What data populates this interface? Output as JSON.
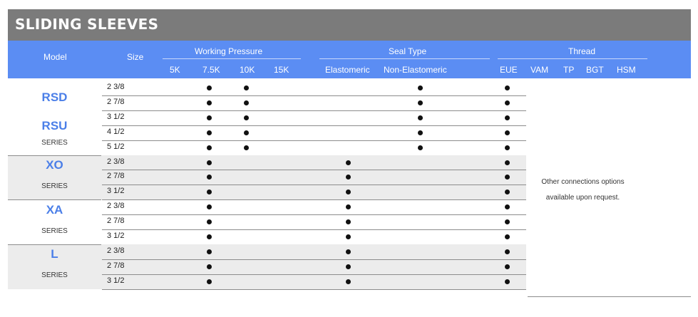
{
  "title": "SLIDING SLEEVES",
  "header": {
    "model": "Model",
    "size": "Size",
    "working_pressure": "Working Pressure",
    "seal_type": "Seal Type",
    "thread": "Thread",
    "sub": {
      "p5k": "5K",
      "p75k": "7.5K",
      "p10k": "10K",
      "p15k": "15K",
      "elastomeric": "Elastomeric",
      "non_elastomeric": "Non-Elastomeric",
      "eue": "EUE",
      "vam": "VAM",
      "tp": "TP",
      "bgt": "BGT",
      "hsm": "HSM"
    }
  },
  "groups": [
    {
      "models": [
        "RSD",
        "RSU"
      ],
      "series": "SERIES",
      "rows": [
        {
          "size": "2 3/8",
          "p75k": true,
          "p10k": true,
          "non_elastomeric": true,
          "eue": true
        },
        {
          "size": "2 7/8",
          "p75k": true,
          "p10k": true,
          "non_elastomeric": true,
          "eue": true
        },
        {
          "size": "3 1/2",
          "p75k": true,
          "p10k": true,
          "non_elastomeric": true,
          "eue": true
        },
        {
          "size": "4 1/2",
          "p75k": true,
          "p10k": true,
          "non_elastomeric": true,
          "eue": true
        },
        {
          "size": "5 1/2",
          "p75k": true,
          "p10k": true,
          "non_elastomeric": true,
          "eue": true
        }
      ]
    },
    {
      "models": [
        "XO"
      ],
      "series": "SERIES",
      "rows": [
        {
          "size": "2 3/8",
          "p75k": true,
          "elastomeric": true,
          "eue": true
        },
        {
          "size": "2 7/8",
          "p75k": true,
          "elastomeric": true,
          "eue": true
        },
        {
          "size": "3 1/2",
          "p75k": true,
          "elastomeric": true,
          "eue": true
        }
      ]
    },
    {
      "models": [
        "XA"
      ],
      "series": "SERIES",
      "rows": [
        {
          "size": "2 3/8",
          "p75k": true,
          "elastomeric": true,
          "eue": true
        },
        {
          "size": "2 7/8",
          "p75k": true,
          "elastomeric": true,
          "eue": true
        },
        {
          "size": "3 1/2",
          "p75k": true,
          "elastomeric": true,
          "eue": true
        }
      ]
    },
    {
      "models": [
        "L"
      ],
      "series": "SERIES",
      "rows": [
        {
          "size": "2 3/8",
          "p75k": true,
          "elastomeric": true,
          "eue": true
        },
        {
          "size": "2 7/8",
          "p75k": true,
          "elastomeric": true,
          "eue": true
        },
        {
          "size": "3 1/2",
          "p75k": true,
          "elastomeric": true,
          "eue": true
        }
      ]
    }
  ],
  "note_line1": "Other connections options",
  "note_line2": "available upon request.",
  "colors": {
    "title_bg": "#7b7b7b",
    "header_bg": "#5b8df3",
    "model_text": "#4b7fe8",
    "alt_row": "#ececec"
  }
}
